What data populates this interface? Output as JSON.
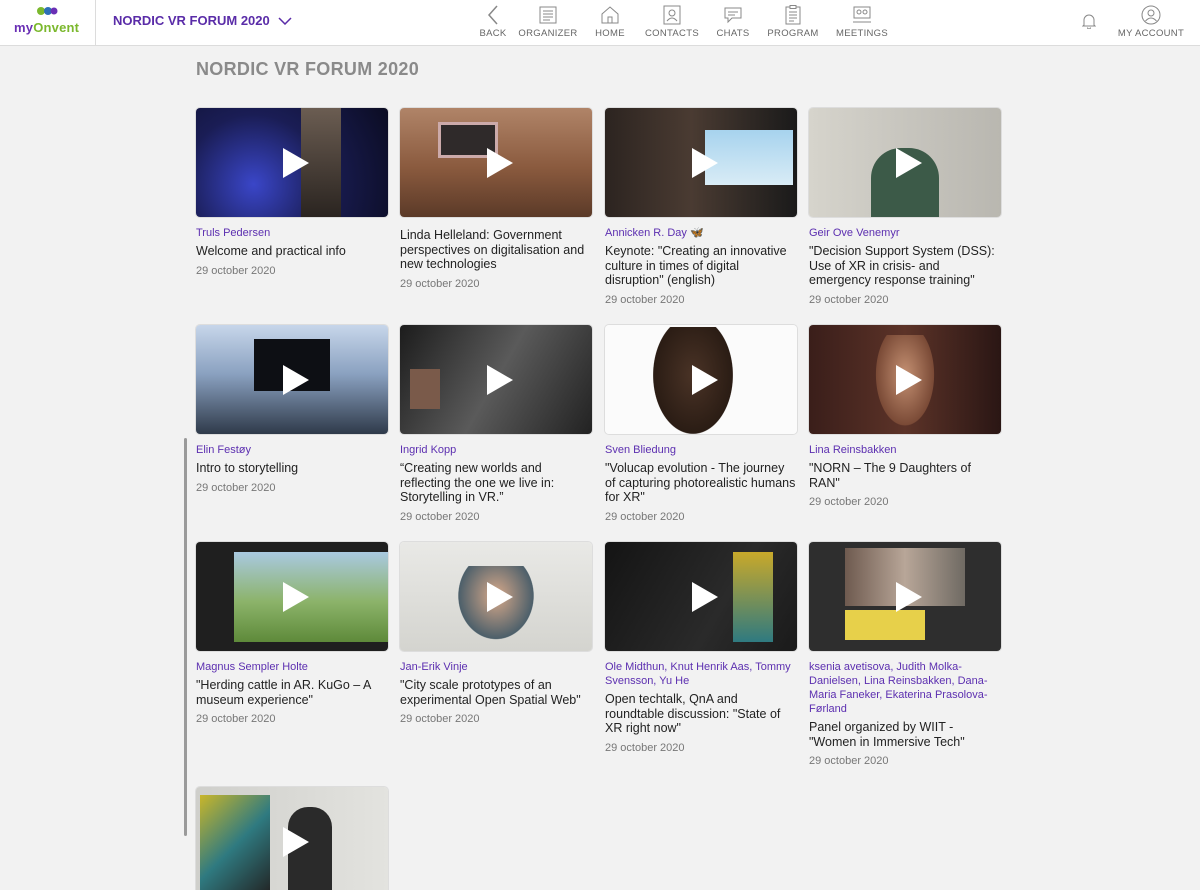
{
  "brand": {
    "logo_my": "my",
    "logo_onvent": "Onvent"
  },
  "event": {
    "name": "NORDIC VR FORUM 2020"
  },
  "nav": [
    {
      "label": "BACK",
      "icon": "chevron-left-icon"
    },
    {
      "label": "ORGANIZER",
      "icon": "document-icon"
    },
    {
      "label": "HOME",
      "icon": "home-icon"
    },
    {
      "label": "CONTACTS",
      "icon": "contacts-icon"
    },
    {
      "label": "CHATS",
      "icon": "chat-icon"
    },
    {
      "label": "PROGRAM",
      "icon": "program-icon"
    },
    {
      "label": "MEETINGS",
      "icon": "meetings-icon"
    }
  ],
  "account": {
    "label": "MY ACCOUNT"
  },
  "page": {
    "title": "NORDIC VR FORUM 2020"
  },
  "videos": [
    {
      "speaker": "Truls Pedersen",
      "title": "Welcome and practical info",
      "date": "29 october 2020"
    },
    {
      "speaker": "",
      "title": "Linda Helleland: Government perspectives on digitalisation and new technologies",
      "date": "29 october 2020"
    },
    {
      "speaker": "Annicken R. Day 🦋",
      "title": "Keynote: \"Creating an innovative culture in times of digital disruption\" (english)",
      "date": "29 october 2020"
    },
    {
      "speaker": "Geir Ove Venemyr",
      "title": "\"Decision Support System (DSS): Use of XR in crisis- and emergency response training\"",
      "date": "29 october 2020"
    },
    {
      "speaker": "Elin Festøy",
      "title": "Intro to storytelling",
      "date": "29 october 2020"
    },
    {
      "speaker": "Ingrid Kopp",
      "title": "“Creating new worlds and reflecting the one we live in: Storytelling in VR.”",
      "date": "29 october 2020"
    },
    {
      "speaker": "Sven Bliedung",
      "title": "\"Volucap evolution - The journey of capturing photorealistic humans for XR\"",
      "date": "29 october 2020"
    },
    {
      "speaker": "Lina Reinsbakken",
      "title": "\"NORN – The 9 Daughters of RAN\"",
      "date": "29 october 2020"
    },
    {
      "speaker": "Magnus Sempler Holte",
      "title": "\"Herding cattle in AR. KuGo – A museum experience\"",
      "date": "29 october 2020"
    },
    {
      "speaker": "Jan-Erik Vinje",
      "title": "\"City scale prototypes of an experimental Open Spatial Web\"",
      "date": "29 october 2020"
    },
    {
      "speaker": "Ole Midthun, Knut Henrik Aas, Tommy Svensson, Yu He",
      "title": "Open techtalk, QnA and roundtable discussion: \"State of XR right now\"",
      "date": "29 october 2020"
    },
    {
      "speaker": "ksenia avetisova, Judith Molka-Danielsen, Lina Reinsbakken, Dana-Maria Faneker, Ekaterina Prasolova-Førland",
      "title": "Panel organized by WIIT - \"Women in Immersive Tech\"",
      "date": "29 october 2020"
    },
    {
      "speaker": "",
      "title": "",
      "date": ""
    }
  ],
  "colors": {
    "accent": "#5c2fb0",
    "logo_green": "#7bb82d"
  }
}
